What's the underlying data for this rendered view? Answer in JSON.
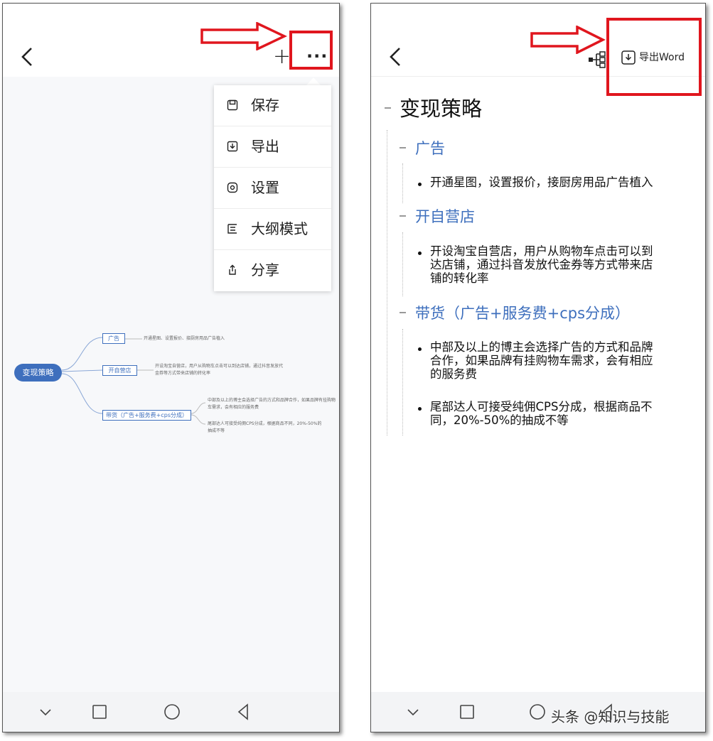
{
  "left": {
    "toolbar": {
      "plus_icon": "plus-icon",
      "more_label": "···"
    },
    "menu": {
      "items": [
        {
          "label": "保存",
          "icon": "save-icon"
        },
        {
          "label": "导出",
          "icon": "export-icon"
        },
        {
          "label": "设置",
          "icon": "settings-icon"
        },
        {
          "label": "大纲模式",
          "icon": "outline-icon"
        },
        {
          "label": "分享",
          "icon": "share-icon"
        }
      ]
    },
    "mindmap": {
      "root": "变现策略",
      "n1": "广告",
      "n1_text": "开通星图、设置报价、接厨房用品广告植入",
      "n2": "开自营店",
      "n2_text1": "开设淘宝自营店，用户从购物车点击可以到达店铺，通过抖音发放代",
      "n2_text2": "金券等方式带来店铺的转化率",
      "n3": "带货（广告+服务费+cps分成）",
      "n3_text1": "中部及以上的博主会选择广告的方式和品牌合作，如果品牌有挂购物",
      "n3_text2": "车需求，会有相应的服务费",
      "n3_text3": "尾部达人可接受纯佣CPS分成，根据商品不同，20%-50%的",
      "n3_text4": "抽成不等"
    }
  },
  "right": {
    "export_label": "导出Word",
    "outline": {
      "title": "变现策略",
      "h_ad": "广告",
      "p_ad": "开通星图，设置报价，接厨房用品广告植入",
      "h_store": "开自营店",
      "p_store_1": "开设淘宝自营店，用户从购物车点击可以到",
      "p_store_2": "达店铺，通过抖音发放代金券等方式带来店",
      "p_store_3": "铺的转化率",
      "h_goods": "带货（广告+服务费+cps分成）",
      "p_goods1_1": "中部及以上的博主会选择广告的方式和品牌",
      "p_goods1_2": "合作，如果品牌有挂购物车需求，会有相应",
      "p_goods1_3": "的服务费",
      "p_goods2_1": "尾部达人可接受纯佣CPS分成，根据商品不",
      "p_goods2_2": "同，20%-50%的抽成不等"
    }
  },
  "watermark": "头条 @知识与技能",
  "colors": {
    "highlight": "#e0161e",
    "accent": "#3e6fbd"
  }
}
